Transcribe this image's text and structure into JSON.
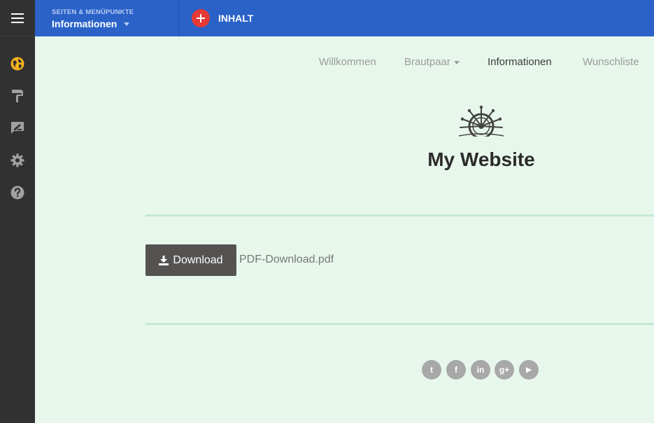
{
  "topbar": {
    "pages_small_label": "SEITEN & MENÜPUNKTE",
    "current_page": "Informationen",
    "add_content_label": "INHALT"
  },
  "sidebar": {
    "items": [
      {
        "icon": "globe-icon",
        "color": "#f2b01e"
      },
      {
        "icon": "paint-roller-icon",
        "color": "#a0a0a0"
      },
      {
        "icon": "feedback-icon",
        "color": "#a0a0a0"
      },
      {
        "icon": "gear-icon",
        "color": "#a0a0a0"
      },
      {
        "icon": "help-icon",
        "color": "#a0a0a0"
      }
    ]
  },
  "site": {
    "nav": [
      {
        "label": "Willkommen"
      },
      {
        "label": "Brautpaar"
      },
      {
        "label": "Informationen"
      },
      {
        "label": "Wunschliste"
      }
    ],
    "title": "My Website",
    "download": {
      "button_label": "Download",
      "file_name": "PDF-Download.pdf"
    },
    "social": [
      {
        "icon": "twitter-icon",
        "glyph": "t"
      },
      {
        "icon": "facebook-icon",
        "glyph": "f"
      },
      {
        "icon": "linkedin-icon",
        "glyph": "in"
      },
      {
        "icon": "google-plus-icon",
        "glyph": "g+"
      },
      {
        "icon": "youtube-icon",
        "glyph": "▶"
      }
    ]
  },
  "colors": {
    "topbar": "#2a62c8",
    "sidebar": "#313131",
    "page_bg": "#e8f7ec",
    "add_button": "#e53935",
    "active_icon": "#f2b01e"
  }
}
